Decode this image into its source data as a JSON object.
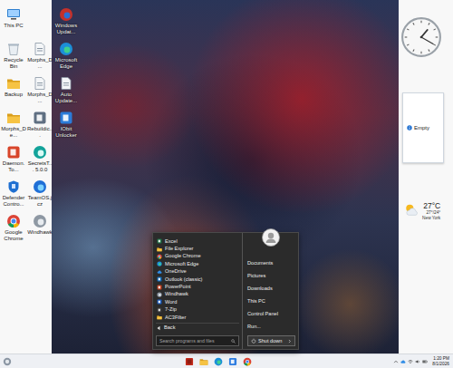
{
  "desktop": {
    "columns": [
      [
        {
          "label": "This PC",
          "kind": "pc"
        },
        {
          "label": "Recycle Bin",
          "kind": "bin"
        },
        {
          "label": "Backup",
          "kind": "folder"
        },
        {
          "label": "Morphs_De...",
          "kind": "folder"
        },
        {
          "label": "Daemon.To...",
          "kind": "daemon"
        },
        {
          "label": "Defender Contro...",
          "kind": "defender"
        },
        {
          "label": "Google Chrome",
          "kind": "chrome"
        }
      ],
      [
        {
          "label": "Morphs_D...",
          "kind": "setup"
        },
        {
          "label": "Morphs_D...",
          "kind": "setup"
        },
        {
          "label": "Rebuildic...",
          "kind": "robot"
        },
        {
          "label": "SecretsT... 5.0.0",
          "kind": "secrets"
        },
        {
          "label": "TeamOS.jcz",
          "kind": "teamos"
        },
        {
          "label": "Windhawk",
          "kind": "windhawk"
        }
      ],
      [
        {
          "label": "Windows Updat...",
          "kind": "update"
        },
        {
          "label": "Microsoft Edge",
          "kind": "edge"
        },
        {
          "label": "Auto Update...",
          "kind": "setup"
        },
        {
          "label": "IObit Unlocker",
          "kind": "unlock"
        }
      ]
    ]
  },
  "gadgets": {
    "clock": {
      "hours": 1,
      "minutes": 20
    },
    "notes": {
      "text": "Empty"
    },
    "weather": {
      "temperature": "27°C",
      "range": "27°/24°",
      "city": "New York"
    }
  },
  "start_menu": {
    "programs": [
      {
        "label": "Excel",
        "kind": "excel"
      },
      {
        "label": "File Explorer",
        "kind": "explorer"
      },
      {
        "label": "Google Chrome",
        "kind": "chrome"
      },
      {
        "label": "Microsoft Edge",
        "kind": "edge"
      },
      {
        "label": "OneDrive",
        "kind": "onedrive"
      },
      {
        "label": "Outlook (classic)",
        "kind": "outlook"
      },
      {
        "label": "PowerPoint",
        "kind": "powerpoint"
      },
      {
        "label": "Windhawk",
        "kind": "windhawk"
      },
      {
        "label": "Word",
        "kind": "word"
      },
      {
        "label": "7-Zip",
        "kind": "zip"
      },
      {
        "label": "AC3Filter",
        "kind": "folder"
      }
    ],
    "back": "Back",
    "search": {
      "placeholder": "Search programs and files"
    },
    "places": [
      "Documents",
      "Pictures",
      "Downloads",
      "This PC",
      "Control Panel",
      "Run..."
    ],
    "shutdown": "Shut down"
  },
  "taskbar": {
    "apps": [
      {
        "kind": "hawk"
      },
      {
        "kind": "explorer"
      },
      {
        "kind": "edge"
      },
      {
        "kind": "store"
      },
      {
        "kind": "chrome"
      }
    ],
    "time": "1:20 PM",
    "date": "8/1/2026"
  }
}
